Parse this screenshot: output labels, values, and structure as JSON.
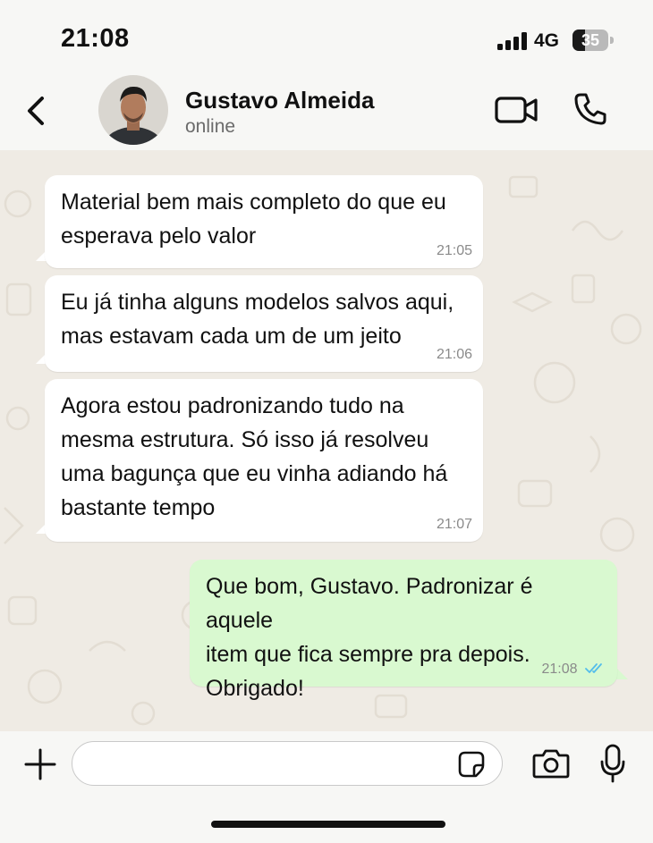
{
  "status_bar": {
    "time": "21:08",
    "network": "4G",
    "battery": "35",
    "battery_level": 0.35
  },
  "header": {
    "back_icon": "chevron-left-icon",
    "contact_name": "Gustavo Almeida",
    "contact_status": "online",
    "video_icon": "video-camera-icon",
    "call_icon": "phone-icon"
  },
  "messages": [
    {
      "direction": "incoming",
      "lines": [
        "Material bem mais completo do que eu",
        "esperava pelo valor"
      ],
      "time": "21:05"
    },
    {
      "direction": "incoming",
      "lines": [
        "Eu já tinha alguns modelos salvos aqui,",
        "mas estavam cada um de um jeito"
      ],
      "time": "21:06"
    },
    {
      "direction": "incoming",
      "lines": [
        "Agora estou padronizando tudo na",
        "mesma estrutura. Só isso já resolveu",
        "uma bagunça que eu vinha adiando há",
        "bastante tempo"
      ],
      "time": "21:07"
    },
    {
      "direction": "outgoing",
      "lines": [
        "Que bom, Gustavo. Padronizar é aquele",
        "item que fica sempre pra depois.",
        "Obrigado!"
      ],
      "time": "21:08",
      "status": "read"
    }
  ],
  "input_bar": {
    "plus_icon": "plus-icon",
    "message_value": "",
    "sticker_icon": "sticker-icon",
    "camera_icon": "camera-icon",
    "mic_icon": "microphone-icon"
  },
  "colors": {
    "incoming_bubble": "#ffffff",
    "outgoing_bubble": "#d9f9d0",
    "read_ticks": "#53bdeb",
    "chat_background": "#efebe4"
  }
}
